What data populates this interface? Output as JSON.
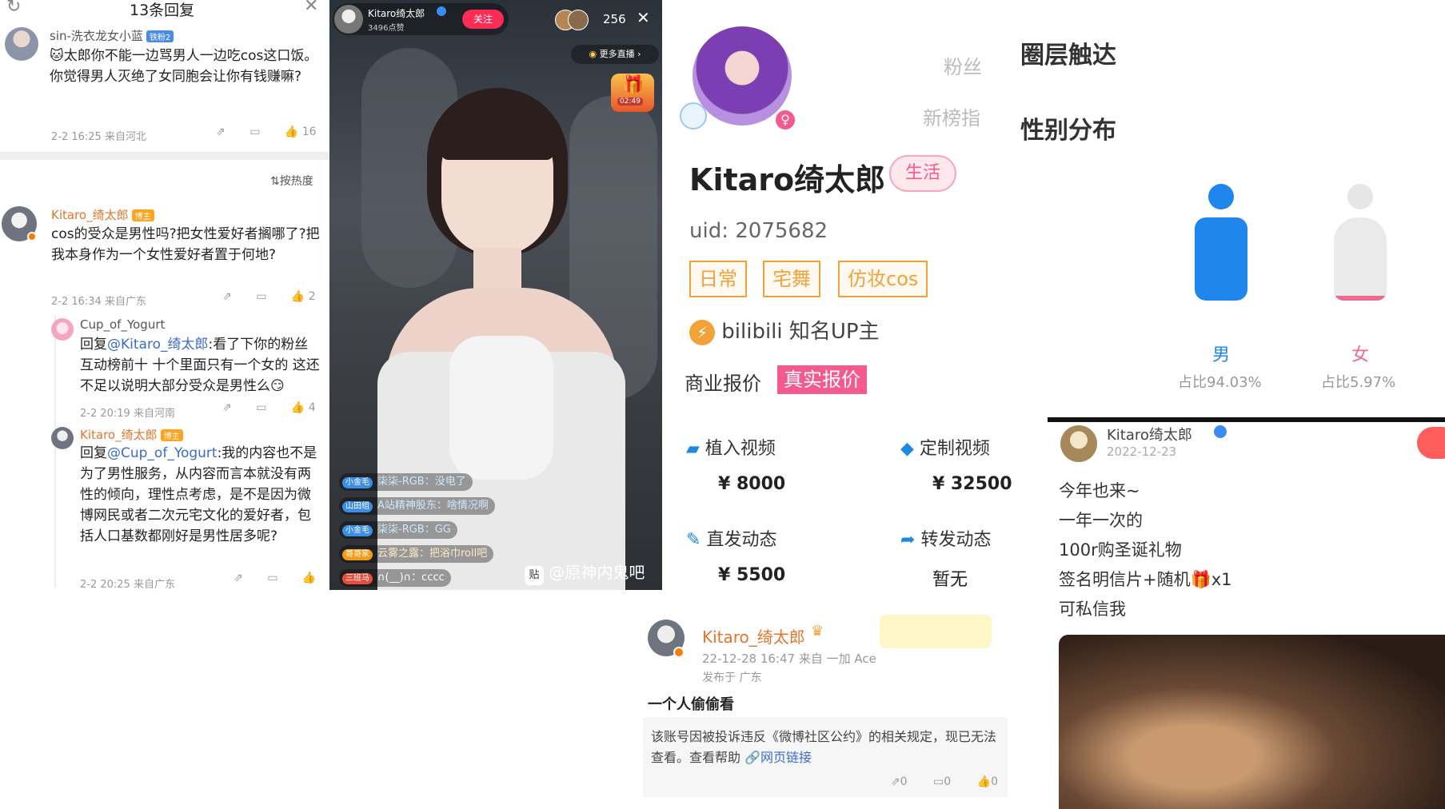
{
  "comments_panel": {
    "title": "13条回复",
    "sort_label": "按热度",
    "c1": {
      "user": "sin-洗衣龙女小蓝",
      "badge": "铁粉2",
      "text": "太郎你不能一边骂男人一边吃cos这口饭。你觉得男人灭绝了女同胞会让你有钱赚嘛?",
      "meta": "2-2 16:25 来自河北",
      "likes": "16"
    },
    "c2": {
      "user": "Kitaro_绮太郎",
      "badge": "博主",
      "text": "cos的受众是男性吗?把女性爱好者搁哪了?把我本身作为一个女性爱好者置于何地?",
      "meta": "2-2 16:34 来自广东",
      "likes": "2"
    },
    "r1": {
      "user": "Cup_of_Yogurt",
      "prefix": "回复",
      "mention": "@Kitaro_绮太郎",
      "text": ":看了下你的粉丝互动榜前十 十个里面只有一个女的 这还不足以说明大部分受众是男性么",
      "meta": "2-2 20:19 来自河南",
      "likes": "4"
    },
    "r2": {
      "user": "Kitaro_绮太郎",
      "badge": "博主",
      "prefix": "回复",
      "mention": "@Cup_of_Yogurt",
      "text": ":我的内容也不是为了男性服务，从内容而言本就没有两性的倾向，理性点考虑，是不是因为微博网民或者二次元宅文化的爱好者，包括人口基数都刚好是男性居多呢?",
      "meta": "2-2 20:25 来自广东"
    }
  },
  "live_panel": {
    "streamer": "Kitaro绮太郎",
    "fans": "3496点赞",
    "follow": "关注",
    "viewers": "256",
    "more_live": "更多直播",
    "timer": "02:49",
    "danmu": [
      {
        "tag": "小金毛",
        "text": "柒柒-RGB：没电了"
      },
      {
        "tag": "山田组",
        "text": "A站精神股东：啥情况啊"
      },
      {
        "tag": "小金毛",
        "text": "柒柒-RGB：GG"
      },
      {
        "tag": "哥哥家",
        "text": "云雾之露：把浴巾roll吧"
      },
      {
        "tag": "三班马",
        "text": "∩(__)∩：cccc"
      }
    ],
    "watermark": "@原神内鬼吧"
  },
  "profile_panel": {
    "name": "Kitaro绮太郎",
    "category": "生活",
    "uid": "uid: 2075682",
    "tags": [
      "日常",
      "宅舞",
      "仿妆cos"
    ],
    "up_label": "bilibili 知名UP主",
    "biz_label": "商业报价",
    "biz_button": "真实报价",
    "fans_label": "粉丝",
    "new_rank_label": "新榜指",
    "circle_title": "圈层触达",
    "gender_title": "性别分布",
    "male_label": "男",
    "male_pct": 0.9403,
    "male_text": "占比94.03%",
    "female_label": "女",
    "female_pct": 0.0597,
    "female_text": "占比5.97%",
    "prices": [
      {
        "label": "植入视频",
        "value": "¥ 8000"
      },
      {
        "label": "定制视频",
        "value": "¥ 32500"
      },
      {
        "label": "直发动态",
        "value": "¥ 5500"
      },
      {
        "label": "转发动态",
        "value": "暂无"
      }
    ]
  },
  "weibo_post": {
    "user": "Kitaro_绮太郎",
    "time": "22-12-28 16:47 来自 一加 Ace",
    "loc": "发布于 广东",
    "text": "一个人偷偷看",
    "notice": "该账号因被投诉违反《微博社区公约》的相关规定，现已无法查看。查看帮助",
    "link": "网页链接",
    "repost": "0",
    "comment": "0",
    "like": "0"
  },
  "gift_post": {
    "user": "Kitaro绮太郎",
    "date": "2022-12-23",
    "lines": [
      "今年也来~",
      "一年一次的",
      "100r购圣诞礼物",
      "签名明信片+随机🎁x1",
      "可私信我"
    ]
  },
  "colors": {
    "accent": "#f45a8d",
    "blue": "#1e88e5",
    "orange": "#f3a23a",
    "male": "#1f86ee",
    "female": "#f06a90"
  }
}
